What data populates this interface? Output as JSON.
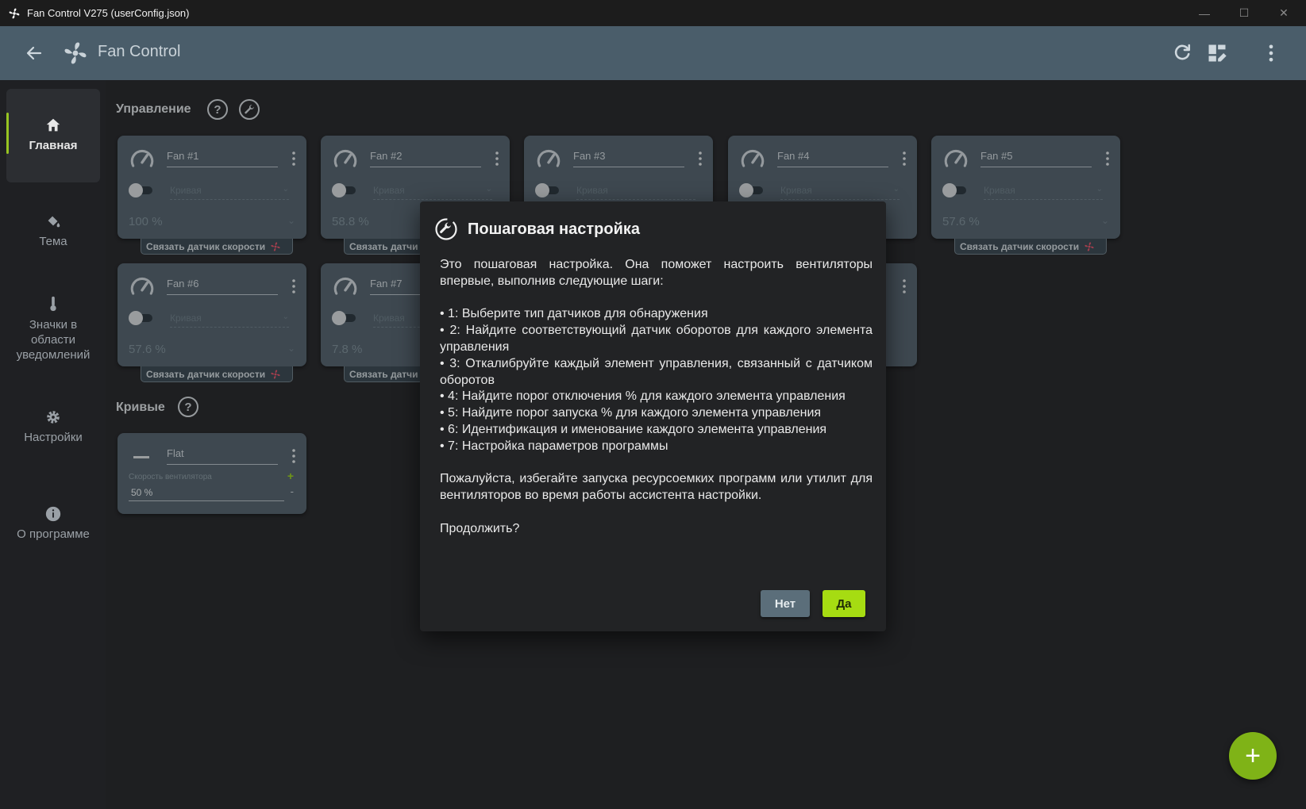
{
  "window": {
    "title": "Fan Control V275 (userConfig.json)",
    "controls": {
      "minimize": "—",
      "maximize": "☐",
      "close": "✕"
    }
  },
  "appbar": {
    "title": "Fan Control",
    "icons": [
      "arrow-left-icon",
      "fan-logo-icon",
      "refresh-icon",
      "dashboard-edit-icon",
      "more-vert-icon"
    ]
  },
  "sidebar": {
    "items": [
      {
        "label": "Главная",
        "icon": "home-icon",
        "active": true
      },
      {
        "label": "Тема",
        "icon": "paint-bucket-icon"
      },
      {
        "label": "Значки в области уведомлений",
        "icon": "thermometer-icon"
      },
      {
        "label": "Настройки",
        "icon": "gear-icon"
      },
      {
        "label": "О программе",
        "icon": "info-icon"
      }
    ]
  },
  "controls_section": {
    "title": "Управление",
    "help": "?"
  },
  "curves_section": {
    "title": "Кривые",
    "help": "?"
  },
  "fan_cards": [
    {
      "name": "Fan #1",
      "curve": "Кривая",
      "percent": "100 %",
      "link_label": "Связать датчик скорости"
    },
    {
      "name": "Fan #2",
      "curve": "Кривая",
      "percent": "58.8 %",
      "link_label": "Связать датчи"
    },
    {
      "name": "Fan #3",
      "curve": "Кривая",
      "percent": "",
      "link_label": ""
    },
    {
      "name": "Fan #4",
      "curve": "Кривая",
      "percent": "",
      "link_label": ""
    },
    {
      "name": "Fan #5",
      "curve": "Кривая",
      "percent": "57.6 %",
      "link_label": "Связать датчик скорости"
    },
    {
      "name": "Fan #6",
      "curve": "Кривая",
      "percent": "57.6 %",
      "link_label": "Связать датчик скорости"
    },
    {
      "name": "Fan #7",
      "curve": "Кривая",
      "percent": "7.8 %",
      "link_label": "Связать датчи"
    }
  ],
  "curve_card": {
    "name": "Flat",
    "label": "Скорость вентилятора",
    "value": "50 %",
    "plus": "+",
    "minus": "-"
  },
  "dialog": {
    "title": "Пошаговая настройка",
    "intro": "Это пошаговая настройка. Она поможет настроить вентиляторы впервые, выполнив следующие шаги:",
    "steps": [
      "• 1: Выберите тип датчиков для обнаружения",
      "• 2: Найдите соответствующий датчик оборотов для каждого элемента управления",
      "• 3: Откалибруйте каждый элемент управления, связанный с датчиком оборотов",
      "• 4: Найдите порог отключения % для каждого элемента управления",
      "• 5: Найдите порог запуска % для каждого элемента управления",
      "• 6: Идентификация и именование каждого элемента управления",
      "• 7: Настройка параметров программы"
    ],
    "warning": "Пожалуйста, избегайте запуска ресурсоемких программ или утилит для вентиляторов во время работы ассистента настройки.",
    "question": "Продолжить?",
    "no_label": "Нет",
    "yes_label": "Да"
  },
  "fab": {
    "label": "+"
  },
  "colors": {
    "accent": "#a6dc12",
    "appbar": "#4a5d6a",
    "card": "#56656f",
    "dialog": "#222325",
    "link_icon": "#e0566b"
  }
}
